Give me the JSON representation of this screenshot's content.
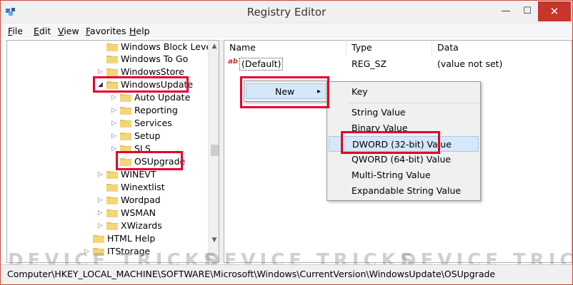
{
  "window": {
    "title": "Registry Editor"
  },
  "titlebar": {
    "minimize_glyph": "—",
    "maximize_glyph": "☐",
    "close_glyph": "✕"
  },
  "menubar": {
    "items": [
      {
        "label": "File",
        "key": "F",
        "rest": "ile"
      },
      {
        "label": "Edit",
        "key": "E",
        "rest": "dit"
      },
      {
        "label": "View",
        "key": "V",
        "rest": "iew"
      },
      {
        "label": "Favorites",
        "key": "F",
        "rest": "avorites",
        "prefix": ""
      },
      {
        "label": "Help",
        "key": "H",
        "rest": "elp"
      }
    ]
  },
  "tree": {
    "items": [
      {
        "label": "Windows Block Level B",
        "expander": ""
      },
      {
        "label": "Windows To Go",
        "expander": ""
      },
      {
        "label": "WindowsStore",
        "expander": "▷"
      },
      {
        "label": "WindowsUpdate",
        "expander": "◢"
      },
      {
        "label": "Auto Update",
        "expander": "▷"
      },
      {
        "label": "Reporting",
        "expander": "▷"
      },
      {
        "label": "Services",
        "expander": "▷"
      },
      {
        "label": "Setup",
        "expander": "▷"
      },
      {
        "label": "SLS",
        "expander": "▷"
      },
      {
        "label": "OSUpgrade",
        "expander": ""
      },
      {
        "label": "WINEVT",
        "expander": "▷"
      },
      {
        "label": "Winextlist",
        "expander": ""
      },
      {
        "label": "Wordpad",
        "expander": "▷"
      },
      {
        "label": "WSMAN",
        "expander": "▷"
      },
      {
        "label": "XWizards",
        "expander": "▷"
      },
      {
        "label": "HTML Help",
        "expander": ""
      },
      {
        "label": "ITStorage",
        "expander": "▷"
      }
    ]
  },
  "list": {
    "columns": [
      "Name",
      "Type",
      "Data"
    ],
    "rows": [
      {
        "icon": "ab",
        "name": "(Default)",
        "type": "REG_SZ",
        "data": "(value not set)"
      }
    ]
  },
  "context_menu": {
    "new_label": "New",
    "submenu_arrow": "▸"
  },
  "new_submenu": {
    "items": [
      "Key",
      "String Value",
      "Binary Value",
      "DWORD (32-bit) Value",
      "QWORD (64-bit) Value",
      "Multi-String Value",
      "Expandable String Value"
    ],
    "highlighted": "DWORD (32-bit) Value"
  },
  "watermark": {
    "text": "DEVICE TRICKS"
  },
  "statusbar": {
    "path": "Computer\\HKEY_LOCAL_MACHINE\\SOFTWARE\\Microsoft\\Windows\\CurrentVersion\\WindowsUpdate\\OSUpgrade"
  },
  "colors": {
    "annotation_red": "#e4002b",
    "close_button": "#c7352b",
    "highlight": "#d5e7f8",
    "folder": "#e8c25a"
  }
}
